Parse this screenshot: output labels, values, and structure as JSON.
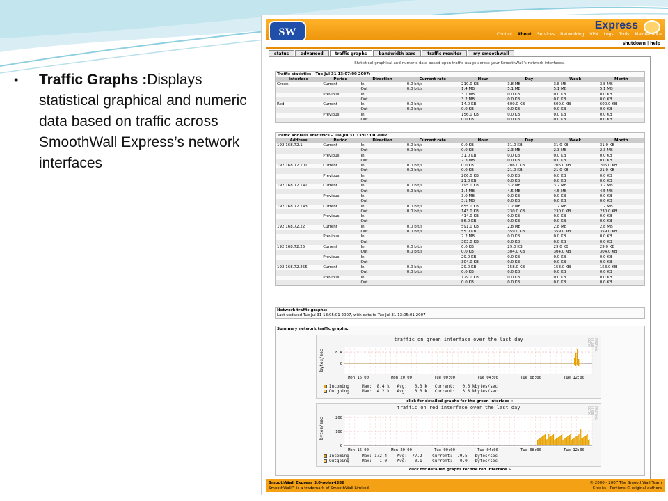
{
  "slide": {
    "bullet_title": "Traffic Graphs :",
    "bullet_text": "Displays statistical graphical and numeric data based on traffic across SmoothWall Express’s network interfaces"
  },
  "app": {
    "logo": "SW",
    "title": "Express",
    "nav": [
      "Control",
      "About",
      "Services",
      "Networking",
      "VPN",
      "Logs",
      "Tools",
      "Maintenance"
    ],
    "nav_active": "About",
    "shutdown": "shutdown | help",
    "tabs": [
      "status",
      "advanced",
      "traffic graphs",
      "bandwidth bars",
      "traffic monitor",
      "my smoothwall"
    ],
    "active_tab": "traffic graphs",
    "intro": "Statistical graphical and numeric data based upon traffic usage across your SmoothWall's network interfaces."
  },
  "traffic_stats": {
    "title": "Traffic statistics - Tue Jul 31 13:07:00 2007:",
    "headers": [
      "Interface",
      "Period",
      "Direction",
      "Current rate",
      "Hour",
      "Day",
      "Week",
      "Month"
    ],
    "rows": [
      [
        "Green",
        "Current",
        "In",
        "0.0 bit/s",
        "210.0 KB",
        "3.8 MB",
        "3.8 MB",
        "3.8 MB"
      ],
      [
        "",
        "",
        "Out",
        "0.0 bit/s",
        "1.4 MB",
        "5.1 MB",
        "5.1 MB",
        "5.1 MB"
      ],
      [
        "",
        "Previous",
        "In",
        "",
        "3.1 MB",
        "0.0 KB",
        "0.0 KB",
        "0.0 KB"
      ],
      [
        "",
        "",
        "Out",
        "",
        "3.2 MB",
        "0.0 KB",
        "0.0 KB",
        "0.0 KB"
      ],
      [
        "Red",
        "Current",
        "In",
        "0.0 bit/s",
        "14.0 KB",
        "600.0 KB",
        "600.0 KB",
        "600.0 KB"
      ],
      [
        "",
        "",
        "Out",
        "0.0 bit/s",
        "0.0 KB",
        "0.0 KB",
        "0.0 KB",
        "0.0 KB"
      ],
      [
        "",
        "Previous",
        "In",
        "",
        "156.0 KB",
        "0.0 KB",
        "0.0 KB",
        "0.0 KB"
      ],
      [
        "",
        "",
        "Out",
        "",
        "0.0 KB",
        "0.0 KB",
        "0.0 KB",
        "0.0 KB"
      ]
    ]
  },
  "address_stats": {
    "title": "Traffic address statistics - Tue Jul 31 13:07:00 2007:",
    "headers": [
      "Address",
      "Period",
      "Direction",
      "Current rate",
      "Hour",
      "Day",
      "Week",
      "Month"
    ],
    "rows": [
      [
        "192.168.72.1",
        "Current",
        "In",
        "0.0 bit/s",
        "0.0 KB",
        "31.0 KB",
        "31.0 KB",
        "31.0 KB"
      ],
      [
        "",
        "",
        "Out",
        "0.0 bit/s",
        "0.0 KB",
        "2.3 MB",
        "2.3 MB",
        "2.3 MB"
      ],
      [
        "",
        "Previous",
        "In",
        "",
        "31.0 KB",
        "0.0 KB",
        "0.0 KB",
        "0.0 KB"
      ],
      [
        "",
        "",
        "Out",
        "",
        "2.3 MB",
        "0.0 KB",
        "0.0 KB",
        "0.0 KB"
      ],
      [
        "192.168.72.101",
        "Current",
        "In",
        "0.0 bit/s",
        "0.0 KB",
        "206.0 KB",
        "206.0 KB",
        "206.0 KB"
      ],
      [
        "",
        "",
        "Out",
        "0.0 bit/s",
        "0.0 KB",
        "21.0 KB",
        "21.0 KB",
        "21.0 KB"
      ],
      [
        "",
        "Previous",
        "In",
        "",
        "206.0 KB",
        "0.0 KB",
        "0.0 KB",
        "0.0 KB"
      ],
      [
        "",
        "",
        "Out",
        "",
        "21.0 KB",
        "0.0 KB",
        "0.0 KB",
        "0.0 KB"
      ],
      [
        "192.168.72.141",
        "Current",
        "In",
        "0.0 bit/s",
        "195.0 KB",
        "3.2 MB",
        "3.2 MB",
        "3.2 MB"
      ],
      [
        "",
        "",
        "Out",
        "0.0 bit/s",
        "1.4 MB",
        "4.5 MB",
        "4.5 MB",
        "4.5 MB"
      ],
      [
        "",
        "Previous",
        "In",
        "",
        "3.0 MB",
        "0.0 KB",
        "0.0 KB",
        "0.0 KB"
      ],
      [
        "",
        "",
        "Out",
        "",
        "3.1 MB",
        "0.0 KB",
        "0.0 KB",
        "0.0 KB"
      ],
      [
        "192.168.72.143",
        "Current",
        "In",
        "0.0 bit/s",
        "855.0 KB",
        "1.2 MB",
        "1.2 MB",
        "1.2 MB"
      ],
      [
        "",
        "",
        "Out",
        "0.0 bit/s",
        "143.0 KB",
        "230.0 KB",
        "230.0 KB",
        "230.0 KB"
      ],
      [
        "",
        "Previous",
        "In",
        "",
        "414.0 KB",
        "0.0 KB",
        "0.0 KB",
        "0.0 KB"
      ],
      [
        "",
        "",
        "Out",
        "",
        "86.0 KB",
        "0.0 KB",
        "0.0 KB",
        "0.0 KB"
      ],
      [
        "192.168.72.22",
        "Current",
        "In",
        "0.0 bit/s",
        "591.0 KB",
        "2.8 MB",
        "2.8 MB",
        "2.8 MB"
      ],
      [
        "",
        "",
        "Out",
        "0.0 bit/s",
        "55.0 KB",
        "359.0 KB",
        "359.0 KB",
        "359.0 KB"
      ],
      [
        "",
        "Previous",
        "In",
        "",
        "2.2 MB",
        "0.0 KB",
        "0.0 KB",
        "0.0 KB"
      ],
      [
        "",
        "",
        "Out",
        "",
        "303.0 KB",
        "0.0 KB",
        "0.0 KB",
        "0.0 KB"
      ],
      [
        "192.168.72.25",
        "Current",
        "In",
        "0.0 bit/s",
        "0.0 KB",
        "29.0 KB",
        "29.0 KB",
        "29.0 KB"
      ],
      [
        "",
        "",
        "Out",
        "0.0 bit/s",
        "0.0 KB",
        "304.0 KB",
        "304.0 KB",
        "304.0 KB"
      ],
      [
        "",
        "Previous",
        "In",
        "",
        "29.0 KB",
        "0.0 KB",
        "0.0 KB",
        "0.0 KB"
      ],
      [
        "",
        "",
        "Out",
        "",
        "304.0 KB",
        "0.0 KB",
        "0.0 KB",
        "0.0 KB"
      ],
      [
        "192.168.72.255",
        "Current",
        "In",
        "0.0 bit/s",
        "29.0 KB",
        "158.0 KB",
        "158.0 KB",
        "158.0 KB"
      ],
      [
        "",
        "",
        "Out",
        "0.0 bit/s",
        "0.0 KB",
        "0.0 KB",
        "0.0 KB",
        "0.0 KB"
      ],
      [
        "",
        "Previous",
        "In",
        "",
        "129.0 KB",
        "0.0 KB",
        "0.0 KB",
        "0.0 KB"
      ],
      [
        "",
        "",
        "Out",
        "",
        "0.0 KB",
        "0.0 KB",
        "0.0 KB",
        "0.0 KB"
      ]
    ]
  },
  "network_graphs": {
    "title": "Network traffic graphs:",
    "updated": "Last updated Tue Jul 31 13:05:01 2007, with data to Tue Jul 31 13:05:01 2007"
  },
  "summary": {
    "title": "Summary network traffic graphs:",
    "graphs": [
      {
        "title": "traffic on green interface over the last day",
        "ylabel": "bytes/sec",
        "yticks": [
          "8 k",
          "0"
        ],
        "xticks": [
          "Mon 16:00",
          "Mon 20:00",
          "Tue 00:00",
          "Tue 04:00",
          "Tue 08:00",
          "Tue 12:00"
        ],
        "legend": [
          "Incoming     Max:  8.4 k   Avg:   0.3 k   Current:   0.6 kbytes/sec",
          "Outgoing     Max:  4.2 k   Avg:   0.3 k   Current:   3.8 kbytes/sec"
        ],
        "link": "click for detailed graphs for the green interface »",
        "side": "RRDTOOL / TOBI OETIKER",
        "color_in": "#e8a200",
        "color_out": "#ffd060"
      },
      {
        "title": "traffic on red interface over the last day",
        "ylabel": "bytes/sec",
        "yticks": [
          "200",
          "100",
          "0"
        ],
        "xticks": [
          "Mon 16:00",
          "Mon 20:00",
          "Tue 00:00",
          "Tue 04:00",
          "Tue 08:00",
          "Tue 12:00"
        ],
        "legend": [
          "Incoming     Max: 172.4    Avg:  77.2    Current:  79.5   bytes/sec",
          "Outgoing     Max:   1.0    Avg:   0.1    Current:   0.0   bytes/sec"
        ],
        "link": "click for detailed graphs for the red interface »",
        "side": "RRDTOOL / TOBI OETIKER",
        "color_in": "#e8a200",
        "color_out": "#ffd060"
      }
    ]
  },
  "footer": {
    "left1": "SmoothWall Express 3.0-polar-i386",
    "left2": "SmoothWall™ is a trademark of SmoothWall Limited.",
    "right1": "© 2000 - 2007 The SmoothWall Team",
    "right2": "Credits - Portions © original authors"
  }
}
